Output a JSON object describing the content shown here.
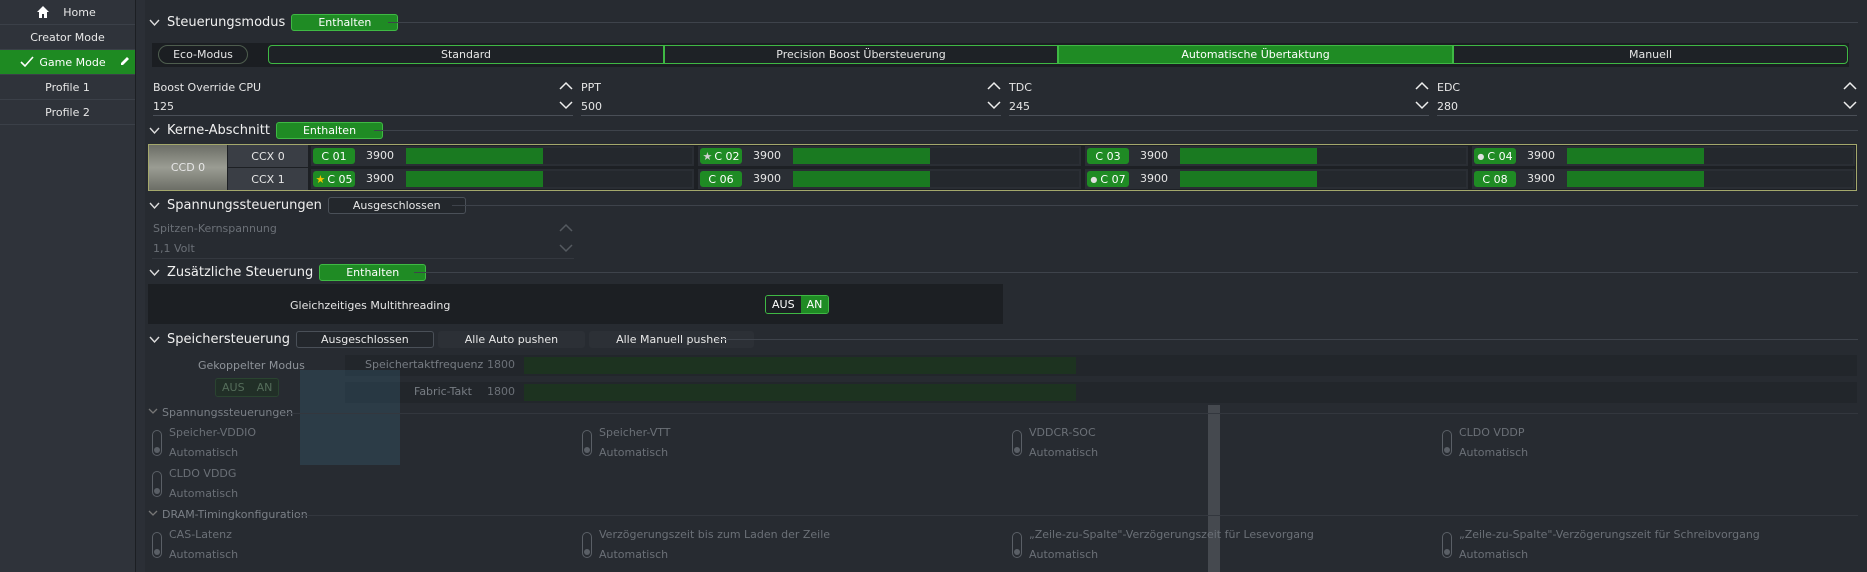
{
  "sidebar": {
    "items": [
      {
        "label": "Home",
        "icon": "home-icon"
      },
      {
        "label": "Creator Mode"
      },
      {
        "label": "Game Mode",
        "icon": "check-icon",
        "action_icon": "pencil-icon"
      },
      {
        "label": "Profile 1"
      },
      {
        "label": "Profile 2"
      }
    ]
  },
  "control_mode": {
    "title": "Steuerungsmodus",
    "badge": "Enthalten",
    "eco": "Eco-Modus",
    "modes": [
      "Standard",
      "Precision Boost Übersteuerung",
      "Automatische Übertaktung",
      "Manuell"
    ],
    "selected_mode": "Automatische Übertaktung",
    "params": [
      {
        "label": "Boost Override CPU",
        "value": "125"
      },
      {
        "label": "PPT",
        "value": "500"
      },
      {
        "label": "TDC",
        "value": "245"
      },
      {
        "label": "EDC",
        "value": "280"
      }
    ]
  },
  "cores": {
    "title": "Kerne-Abschnitt",
    "badge": "Enthalten",
    "ccd": "CCD 0",
    "ccx": [
      "CCX 0",
      "CCX 1"
    ],
    "list": [
      {
        "name": "C 01",
        "value": "3900",
        "fill": 0.48,
        "marker": "none"
      },
      {
        "name": "C 02",
        "value": "3900",
        "fill": 0.48,
        "marker": "star-gray"
      },
      {
        "name": "C 03",
        "value": "3900",
        "fill": 0.48,
        "marker": "none"
      },
      {
        "name": "C 04",
        "value": "3900",
        "fill": 0.48,
        "marker": "dot"
      },
      {
        "name": "C 05",
        "value": "3900",
        "fill": 0.48,
        "marker": "star-gold"
      },
      {
        "name": "C 06",
        "value": "3900",
        "fill": 0.48,
        "marker": "none"
      },
      {
        "name": "C 07",
        "value": "3900",
        "fill": 0.48,
        "marker": "dot"
      },
      {
        "name": "C 08",
        "value": "3900",
        "fill": 0.48,
        "marker": "none"
      }
    ]
  },
  "voltage": {
    "title": "Spannungssteuerungen",
    "badge": "Ausgeschlossen",
    "label": "Spitzen-Kernspannung",
    "value": "1,1 Volt"
  },
  "additional": {
    "title": "Zusätzliche Steuerung",
    "badge": "Enthalten",
    "smt_label": "Gleichzeitiges Multithreading",
    "off": "AUS",
    "on": "AN"
  },
  "memory": {
    "title": "Speichersteuerung",
    "badge": "Ausgeschlossen",
    "push_auto": "Alle Auto pushen",
    "push_manual": "Alle Manuell pushen",
    "coupled": "Gekoppelter Modus",
    "off": "AUS",
    "on": "AN",
    "mem_clock_label": "Speichertaktfrequenz",
    "mem_clock": "1800",
    "fabric_label": "Fabric-Takt",
    "fabric": "1800",
    "voltage_sub": "Spannungssteuerungen",
    "voltages": [
      {
        "label": "Speicher-VDDIO",
        "value": "Automatisch"
      },
      {
        "label": "Speicher-VTT",
        "value": "Automatisch"
      },
      {
        "label": "VDDCR-SOC",
        "value": "Automatisch"
      },
      {
        "label": "CLDO VDDP",
        "value": "Automatisch"
      },
      {
        "label": "CLDO VDDG",
        "value": "Automatisch"
      }
    ],
    "timing_sub": "DRAM-Timingkonfiguration",
    "timings": [
      {
        "label": "CAS-Latenz",
        "value": "Automatisch"
      },
      {
        "label": "Verzögerungszeit bis zum Laden der Zeile",
        "value": "Automatisch"
      },
      {
        "label": "„Zeile-zu-Spalte\"-Verzögerungszeit für Lesevorgang",
        "value": "Automatisch"
      },
      {
        "label": "„Zeile-zu-Spalte\"-Verzögerungszeit für Schreibvorgang",
        "value": "Automatisch"
      }
    ]
  }
}
